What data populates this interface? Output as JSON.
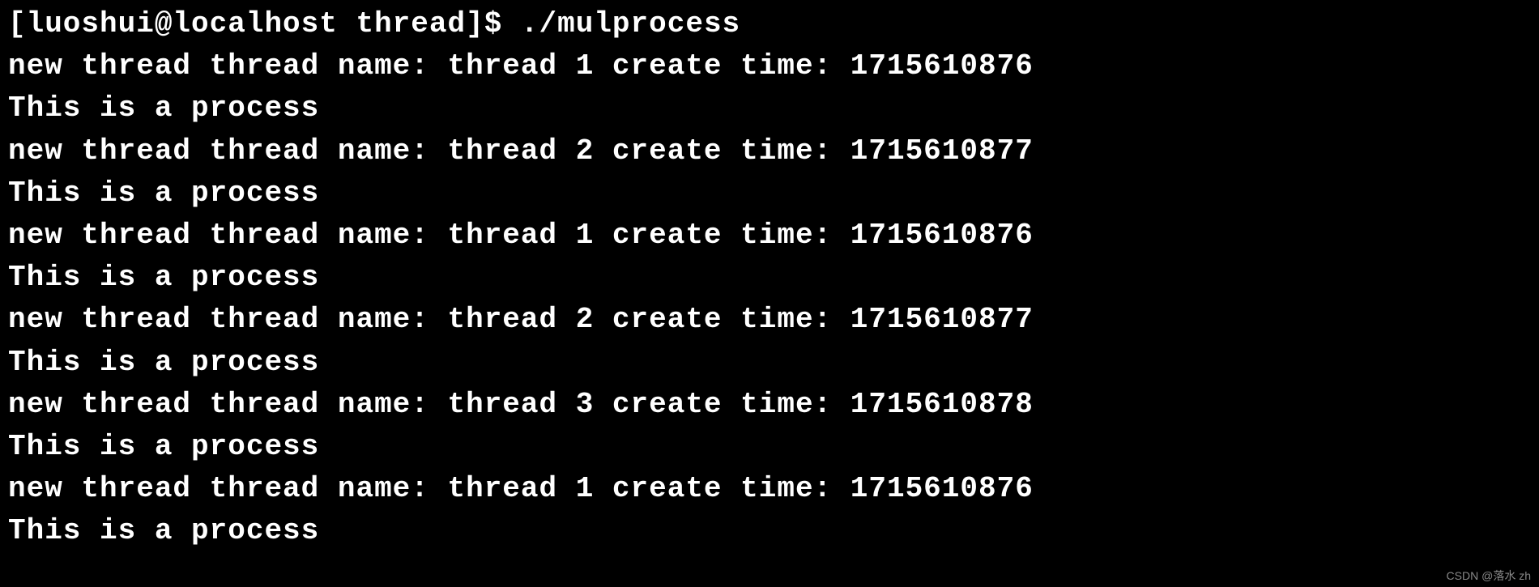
{
  "terminal": {
    "prompt": "[luoshui@localhost thread]$ ",
    "command": "./mulprocess",
    "lines": [
      "new thread thread name: thread 1 create time: 1715610876",
      "This is a process",
      "new thread thread name: thread 2 create time: 1715610877",
      "This is a process",
      "new thread thread name: thread 1 create time: 1715610876",
      "This is a process",
      "new thread thread name: thread 2 create time: 1715610877",
      "This is a process",
      "new thread thread name: thread 3 create time: 1715610878",
      "This is a process",
      "new thread thread name: thread 1 create time: 1715610876",
      "This is a process"
    ]
  },
  "watermark": "CSDN @落水 zh"
}
